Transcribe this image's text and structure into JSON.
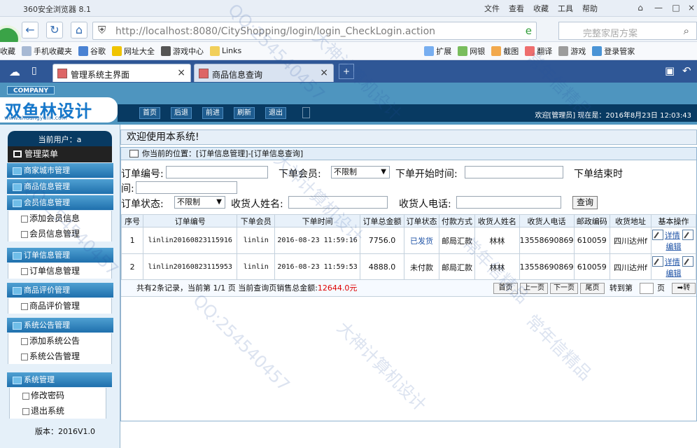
{
  "browser": {
    "title": "360安全浏览器 8.1",
    "menu": [
      "文件",
      "查看",
      "收藏",
      "工具",
      "帮助"
    ],
    "url": "http://localhost:8080/CityShopping/login/login_CheckLogin.action",
    "search_placeholder": "完整家居方案",
    "bookmarks": [
      "收藏",
      "手机收藏夹",
      "谷歌",
      "网址大全",
      "游戏中心",
      "Links",
      "扩展",
      "网银",
      "截图",
      "翻译",
      "游戏",
      "登录管家"
    ],
    "tabs": [
      {
        "label": "管理系统主界面"
      },
      {
        "label": "商品信息查询"
      }
    ]
  },
  "header": {
    "company": "COMPANY",
    "brand": "双鱼林设计",
    "site": "www.shuangyulin.com",
    "buttons": [
      "首页",
      "后退",
      "前进",
      "刷新",
      "退出"
    ],
    "welcome": "欢迎[管理员]  现在是：2016年8月23日 12:03:43"
  },
  "sidebar": {
    "current_user": "当前用户：a",
    "menu_title": "管理菜单",
    "items": [
      {
        "label": "商家城市管理"
      },
      {
        "label": "商品信息管理"
      },
      {
        "label": "会员信息管理"
      },
      {
        "label": "添加会员信息"
      },
      {
        "label": "会员信息管理"
      },
      {
        "label": "订单信息管理"
      },
      {
        "label": "订单信息管理"
      },
      {
        "label": "商品评价管理"
      },
      {
        "label": "商品评价管理"
      },
      {
        "label": "系统公告管理"
      },
      {
        "label": "添加系统公告"
      },
      {
        "label": "系统公告管理"
      },
      {
        "label": "系统管理"
      },
      {
        "label": "修改密码"
      },
      {
        "label": "退出系统"
      }
    ],
    "version": "版本：2016V1.0"
  },
  "main": {
    "welcome": "欢迎使用本系统!",
    "breadcrumb": "你当前的位置：[订单信息管理]-[订单信息查询]",
    "filters": {
      "order_no": "订单编号:",
      "member": "下单会员:",
      "member_value": "不限制",
      "start": "下单开始时间:",
      "end": "下单结束时",
      "end_tail": "间:",
      "status": "订单状态:",
      "status_value": "不限制",
      "receiver": "收货人姓名:",
      "phone": "收货人电话:",
      "query": "查询"
    },
    "columns": [
      "序号",
      "订单编号",
      "下单会员",
      "下单时间",
      "订单总金额",
      "订单状态",
      "付款方式",
      "收货人姓名",
      "收货人电话",
      "邮政编码",
      "收货地址",
      "基本操作"
    ],
    "rows": [
      {
        "no": "1",
        "order_no": "linlin20160823115916",
        "member": "linlin",
        "time": "2016-08-23 11:59:16",
        "amount": "7756.0",
        "status": "已发货",
        "payment": "邮局汇款",
        "receiver": "林林",
        "phone": "13558690869",
        "postcode": "610059",
        "address": "四川达州f",
        "op1": "详情",
        "op2": "编辑"
      },
      {
        "no": "2",
        "order_no": "linlin20160823115953",
        "member": "linlin",
        "time": "2016-08-23 11:59:53",
        "amount": "4888.0",
        "status": "未付款",
        "payment": "邮局汇款",
        "receiver": "林林",
        "phone": "13558690869",
        "postcode": "610059",
        "address": "四川达州f",
        "op1": "详情",
        "op2": "编辑"
      }
    ],
    "pager": {
      "summary": "共有2条记录，当前第 1/1 页   当前查询页销售总金额:",
      "total": "12644.0元",
      "buttons": [
        "首页",
        "上一页",
        "下一页",
        "尾页"
      ],
      "goto": "转到第",
      "page": "页",
      "jump": "转"
    }
  },
  "watermarks": [
    "QQ:254540457",
    "大神计算机设计",
    "常年信精品",
    "QQ:254540457",
    "大神计算机设计",
    "常年信精品",
    "QQ:254540457",
    "大神计算机设计",
    "常年信精品"
  ]
}
